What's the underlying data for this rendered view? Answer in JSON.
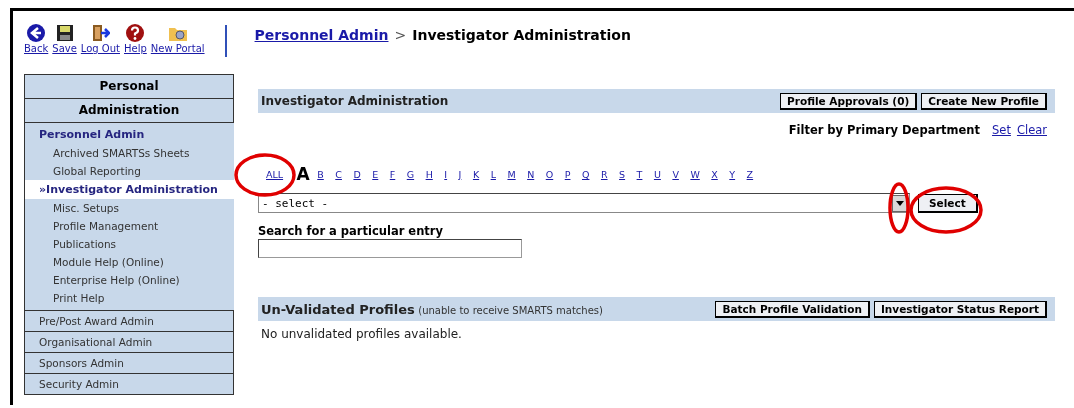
{
  "toolbar": [
    {
      "label": "Back",
      "kind": "back"
    },
    {
      "label": "Save",
      "kind": "save"
    },
    {
      "label": "Log Out",
      "kind": "logout"
    },
    {
      "label": "Help",
      "kind": "help"
    },
    {
      "label": "New Portal",
      "kind": "portal"
    }
  ],
  "breadcrumb": {
    "link": "Personnel Admin",
    "separator": ">",
    "current": "Investigator Administration"
  },
  "sidebar": {
    "headers": [
      "Personal",
      "Administration"
    ],
    "sections": [
      {
        "label": "Personnel Admin",
        "expanded": true,
        "children": [
          {
            "label": "Archived SMARTSs Sheets",
            "selected": false
          },
          {
            "label": "Global Reporting",
            "selected": false
          },
          {
            "label": "Investigator Administration",
            "selected": true,
            "marker": "»"
          },
          {
            "label": "Misc. Setups",
            "selected": false
          },
          {
            "label": "Profile Management",
            "selected": false
          },
          {
            "label": "Publications",
            "selected": false
          },
          {
            "label": "Module Help (Online)",
            "selected": false
          },
          {
            "label": "Enterprise Help (Online)",
            "selected": false
          },
          {
            "label": "Print Help",
            "selected": false
          }
        ]
      },
      {
        "label": "Pre/Post Award Admin",
        "expanded": false
      },
      {
        "label": "Organisational Admin",
        "expanded": false
      },
      {
        "label": "Sponsors Admin",
        "expanded": false
      },
      {
        "label": "Security Admin",
        "expanded": false
      }
    ]
  },
  "panel": {
    "title": "Investigator Administration",
    "buttons": [
      "Profile Approvals (0)",
      "Create New Profile"
    ],
    "filter": {
      "label": "Filter by Primary Department",
      "links": [
        "Set",
        "Clear"
      ]
    },
    "letters": [
      {
        "label": "ALL",
        "selected": false
      },
      {
        "label": "A",
        "selected": true
      },
      {
        "label": "B",
        "selected": false
      },
      {
        "label": "C",
        "selected": false
      },
      {
        "label": "D",
        "selected": false
      },
      {
        "label": "E",
        "selected": false
      },
      {
        "label": "F",
        "selected": false
      },
      {
        "label": "G",
        "selected": false
      },
      {
        "label": "H",
        "selected": false
      },
      {
        "label": "I",
        "selected": false
      },
      {
        "label": "J",
        "selected": false
      },
      {
        "label": "K",
        "selected": false
      },
      {
        "label": "L",
        "selected": false
      },
      {
        "label": "M",
        "selected": false
      },
      {
        "label": "N",
        "selected": false
      },
      {
        "label": "O",
        "selected": false
      },
      {
        "label": "P",
        "selected": false
      },
      {
        "label": "Q",
        "selected": false
      },
      {
        "label": "R",
        "selected": false
      },
      {
        "label": "S",
        "selected": false
      },
      {
        "label": "T",
        "selected": false
      },
      {
        "label": "U",
        "selected": false
      },
      {
        "label": "V",
        "selected": false
      },
      {
        "label": "W",
        "selected": false
      },
      {
        "label": "X",
        "selected": false
      },
      {
        "label": "Y",
        "selected": false
      },
      {
        "label": "Z",
        "selected": false
      }
    ],
    "dropdown": {
      "value": "- select -"
    },
    "select_button": "Select",
    "search": {
      "label": "Search for a particular entry"
    }
  },
  "unvalidated": {
    "title": "Un-Validated Profiles",
    "note": "(unable to receive SMARTS matches)",
    "buttons": [
      "Batch Profile Validation",
      "Investigator Status Report"
    ],
    "message": "No unvalidated profiles available."
  }
}
